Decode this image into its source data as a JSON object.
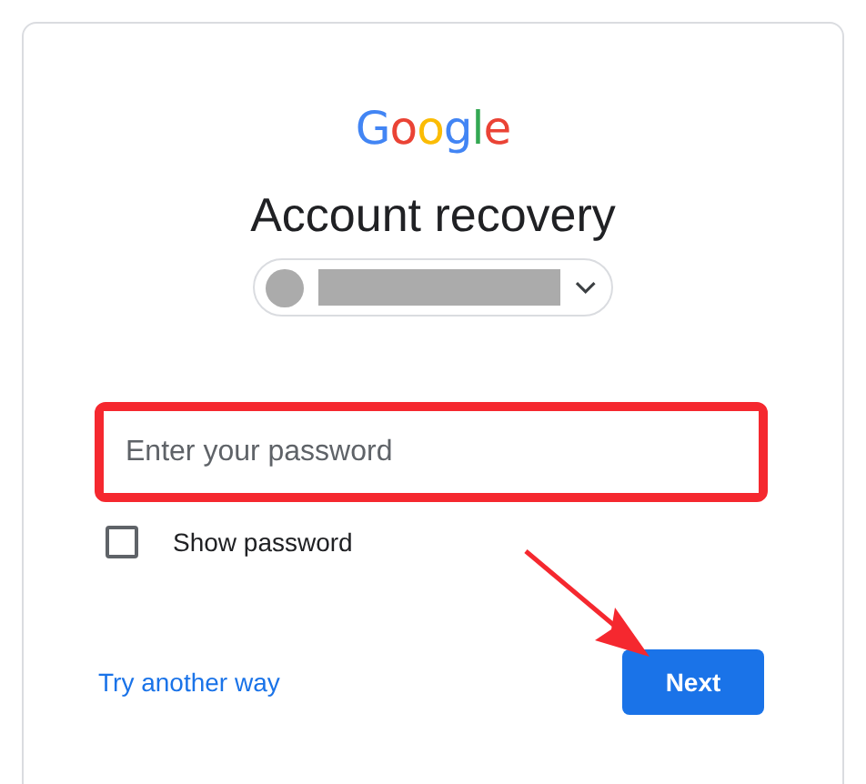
{
  "logo": {
    "letters": [
      {
        "text": "G",
        "color": "#4285f4"
      },
      {
        "text": "o",
        "color": "#ea4335"
      },
      {
        "text": "o",
        "color": "#fbbc05"
      },
      {
        "text": "g",
        "color": "#4285f4"
      },
      {
        "text": "l",
        "color": "#34a853"
      },
      {
        "text": "e",
        "color": "#ea4335"
      }
    ]
  },
  "title": "Account recovery",
  "password_field": {
    "placeholder": "Enter your password"
  },
  "show_password": {
    "label": "Show password",
    "checked": false
  },
  "link": "Try another way",
  "next_button": "Next"
}
